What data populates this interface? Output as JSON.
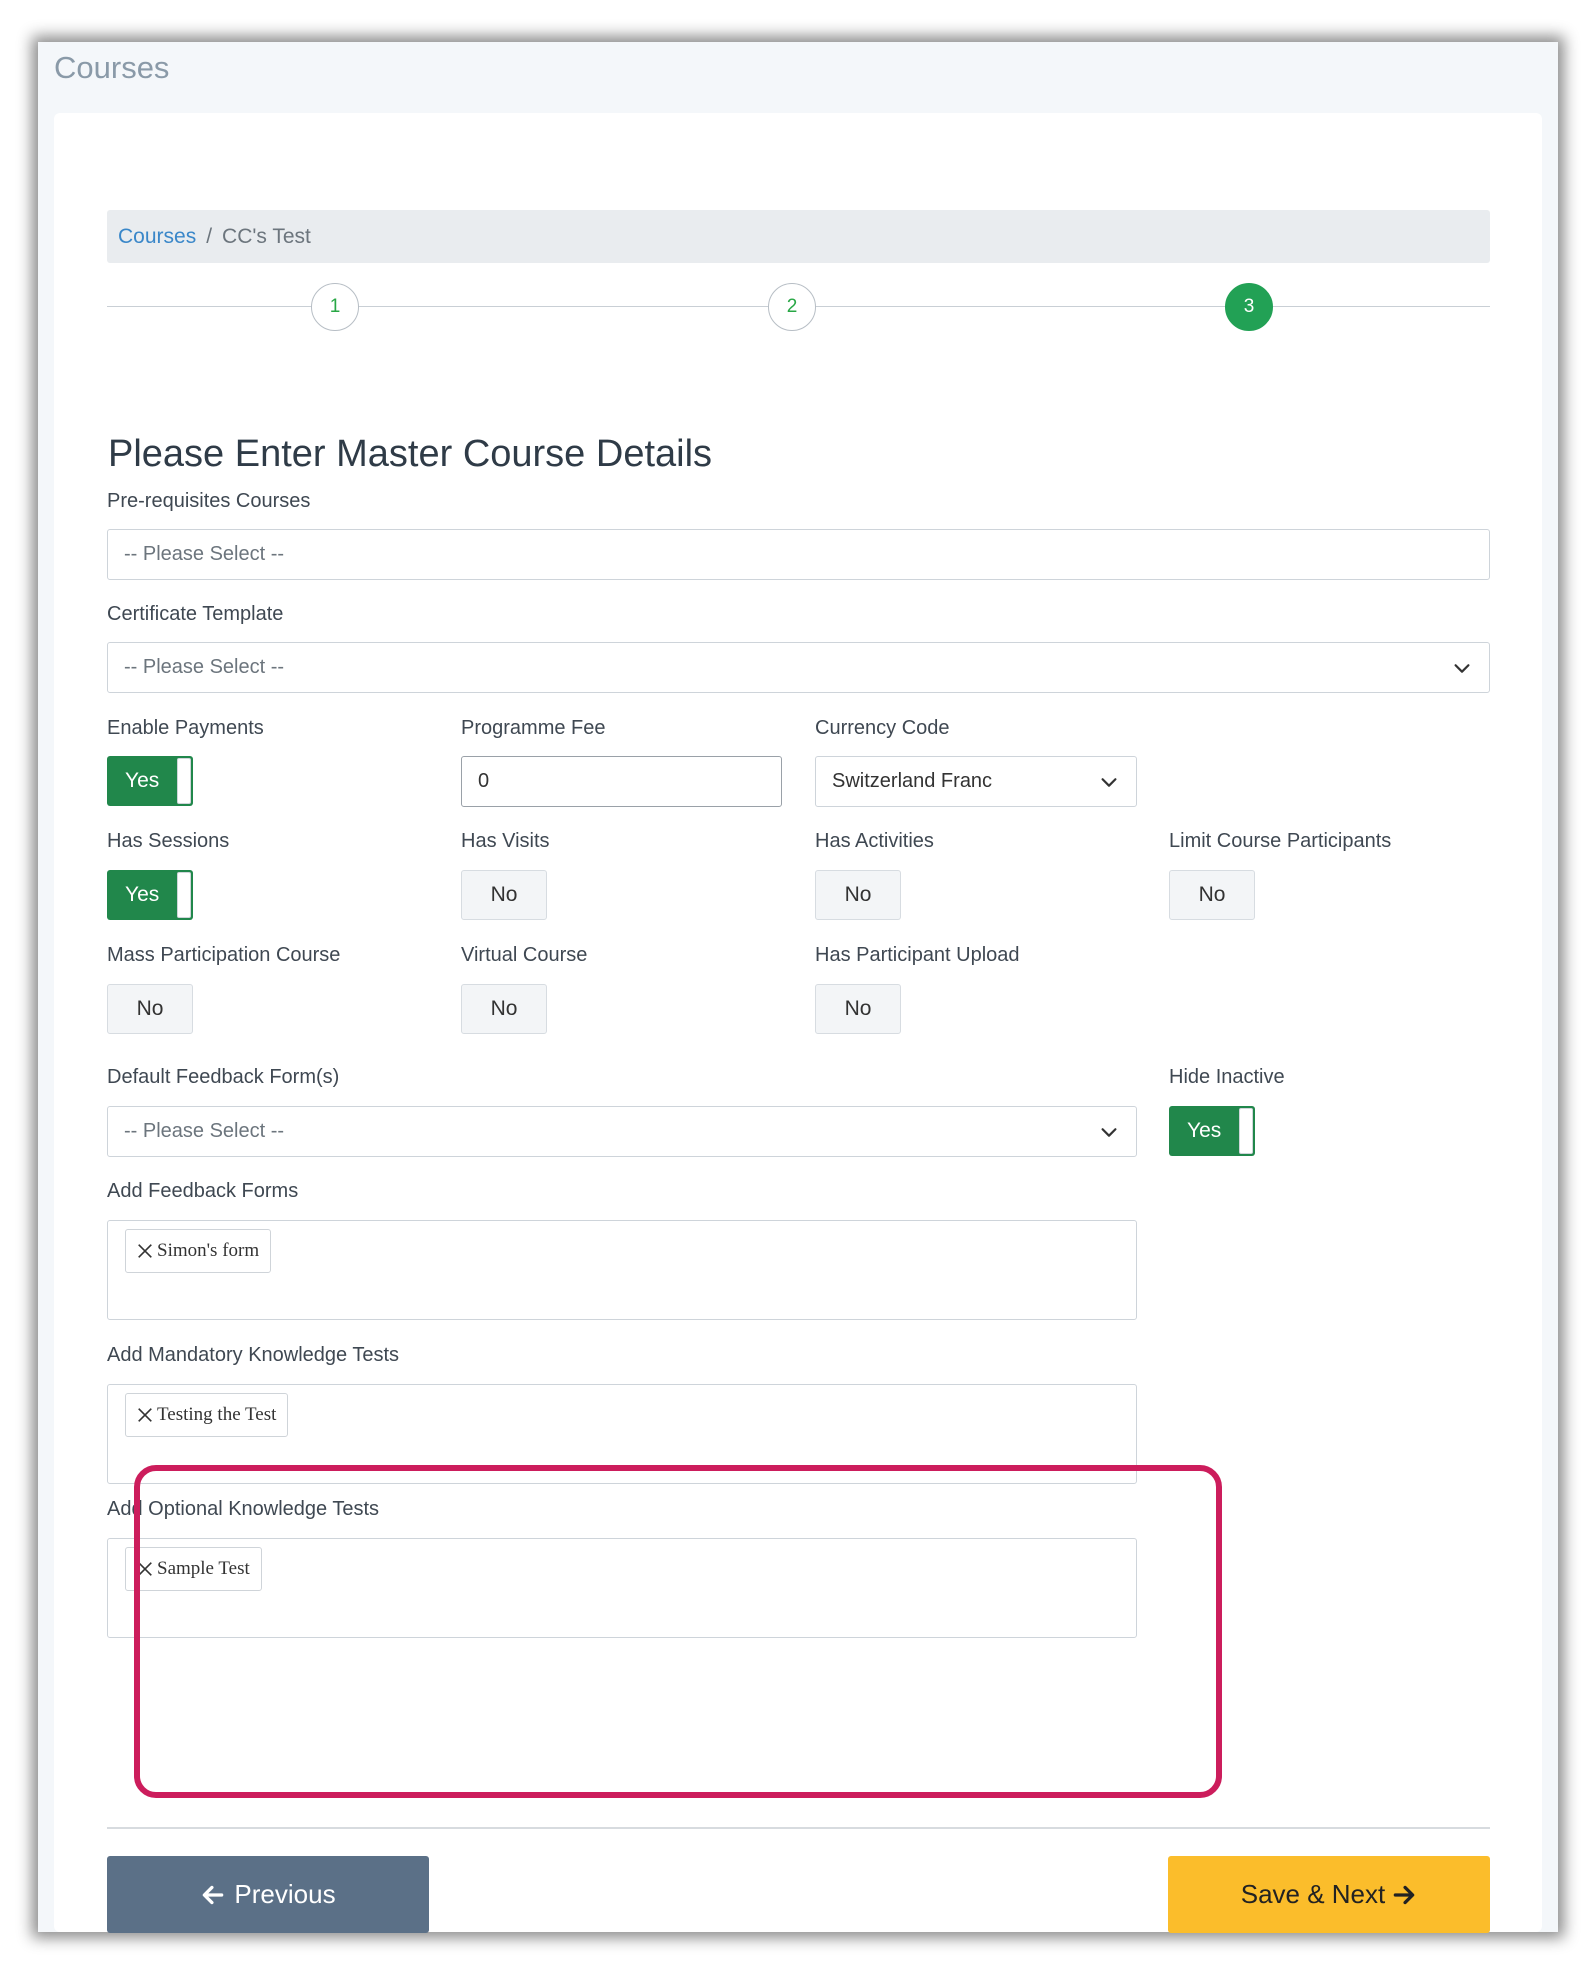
{
  "page": {
    "heading": "Courses"
  },
  "breadcrumb": {
    "link": "Courses",
    "separator": "/",
    "current": "CC's Test"
  },
  "stepper": {
    "steps": [
      "1",
      "2",
      "3"
    ],
    "active_step": 3
  },
  "form": {
    "title": "Please Enter Master Course Details",
    "prerequisites": {
      "label": "Pre-requisites Courses",
      "placeholder": "-- Please Select --"
    },
    "certificate": {
      "label": "Certificate Template",
      "placeholder": "-- Please Select --"
    },
    "enable_payments": {
      "label": "Enable Payments",
      "value": "Yes"
    },
    "programme_fee": {
      "label": "Programme Fee",
      "value": "0"
    },
    "currency_code": {
      "label": "Currency Code",
      "value": "Switzerland Franc"
    },
    "has_sessions": {
      "label": "Has Sessions",
      "value": "Yes"
    },
    "has_visits": {
      "label": "Has Visits",
      "value": "No"
    },
    "has_activities": {
      "label": "Has Activities",
      "value": "No"
    },
    "limit_participants": {
      "label": "Limit Course Participants",
      "value": "No"
    },
    "mass_participation": {
      "label": "Mass Participation Course",
      "value": "No"
    },
    "virtual_course": {
      "label": "Virtual Course",
      "value": "No"
    },
    "participant_upload": {
      "label": "Has Participant Upload",
      "value": "No"
    },
    "default_feedback": {
      "label": "Default Feedback Form(s)",
      "placeholder": "-- Please Select --"
    },
    "hide_inactive": {
      "label": "Hide Inactive",
      "value": "Yes"
    },
    "feedback_forms": {
      "label": "Add Feedback Forms",
      "tags": [
        "Simon's form"
      ]
    },
    "mandatory_tests": {
      "label": "Add Mandatory Knowledge Tests",
      "tags": [
        "Testing the Test"
      ]
    },
    "optional_tests": {
      "label": "Add Optional Knowledge Tests",
      "tags": [
        "Sample Test"
      ]
    }
  },
  "actions": {
    "previous": "Previous",
    "save_next": "Save & Next"
  },
  "colors": {
    "accent_green": "#21874b",
    "highlight": "#cc1d5c",
    "save_button": "#fbbd2b",
    "previous_button": "#5b7087"
  },
  "icons": [
    "chevron-down-icon",
    "close-icon",
    "arrow-left-icon",
    "arrow-right-icon"
  ]
}
